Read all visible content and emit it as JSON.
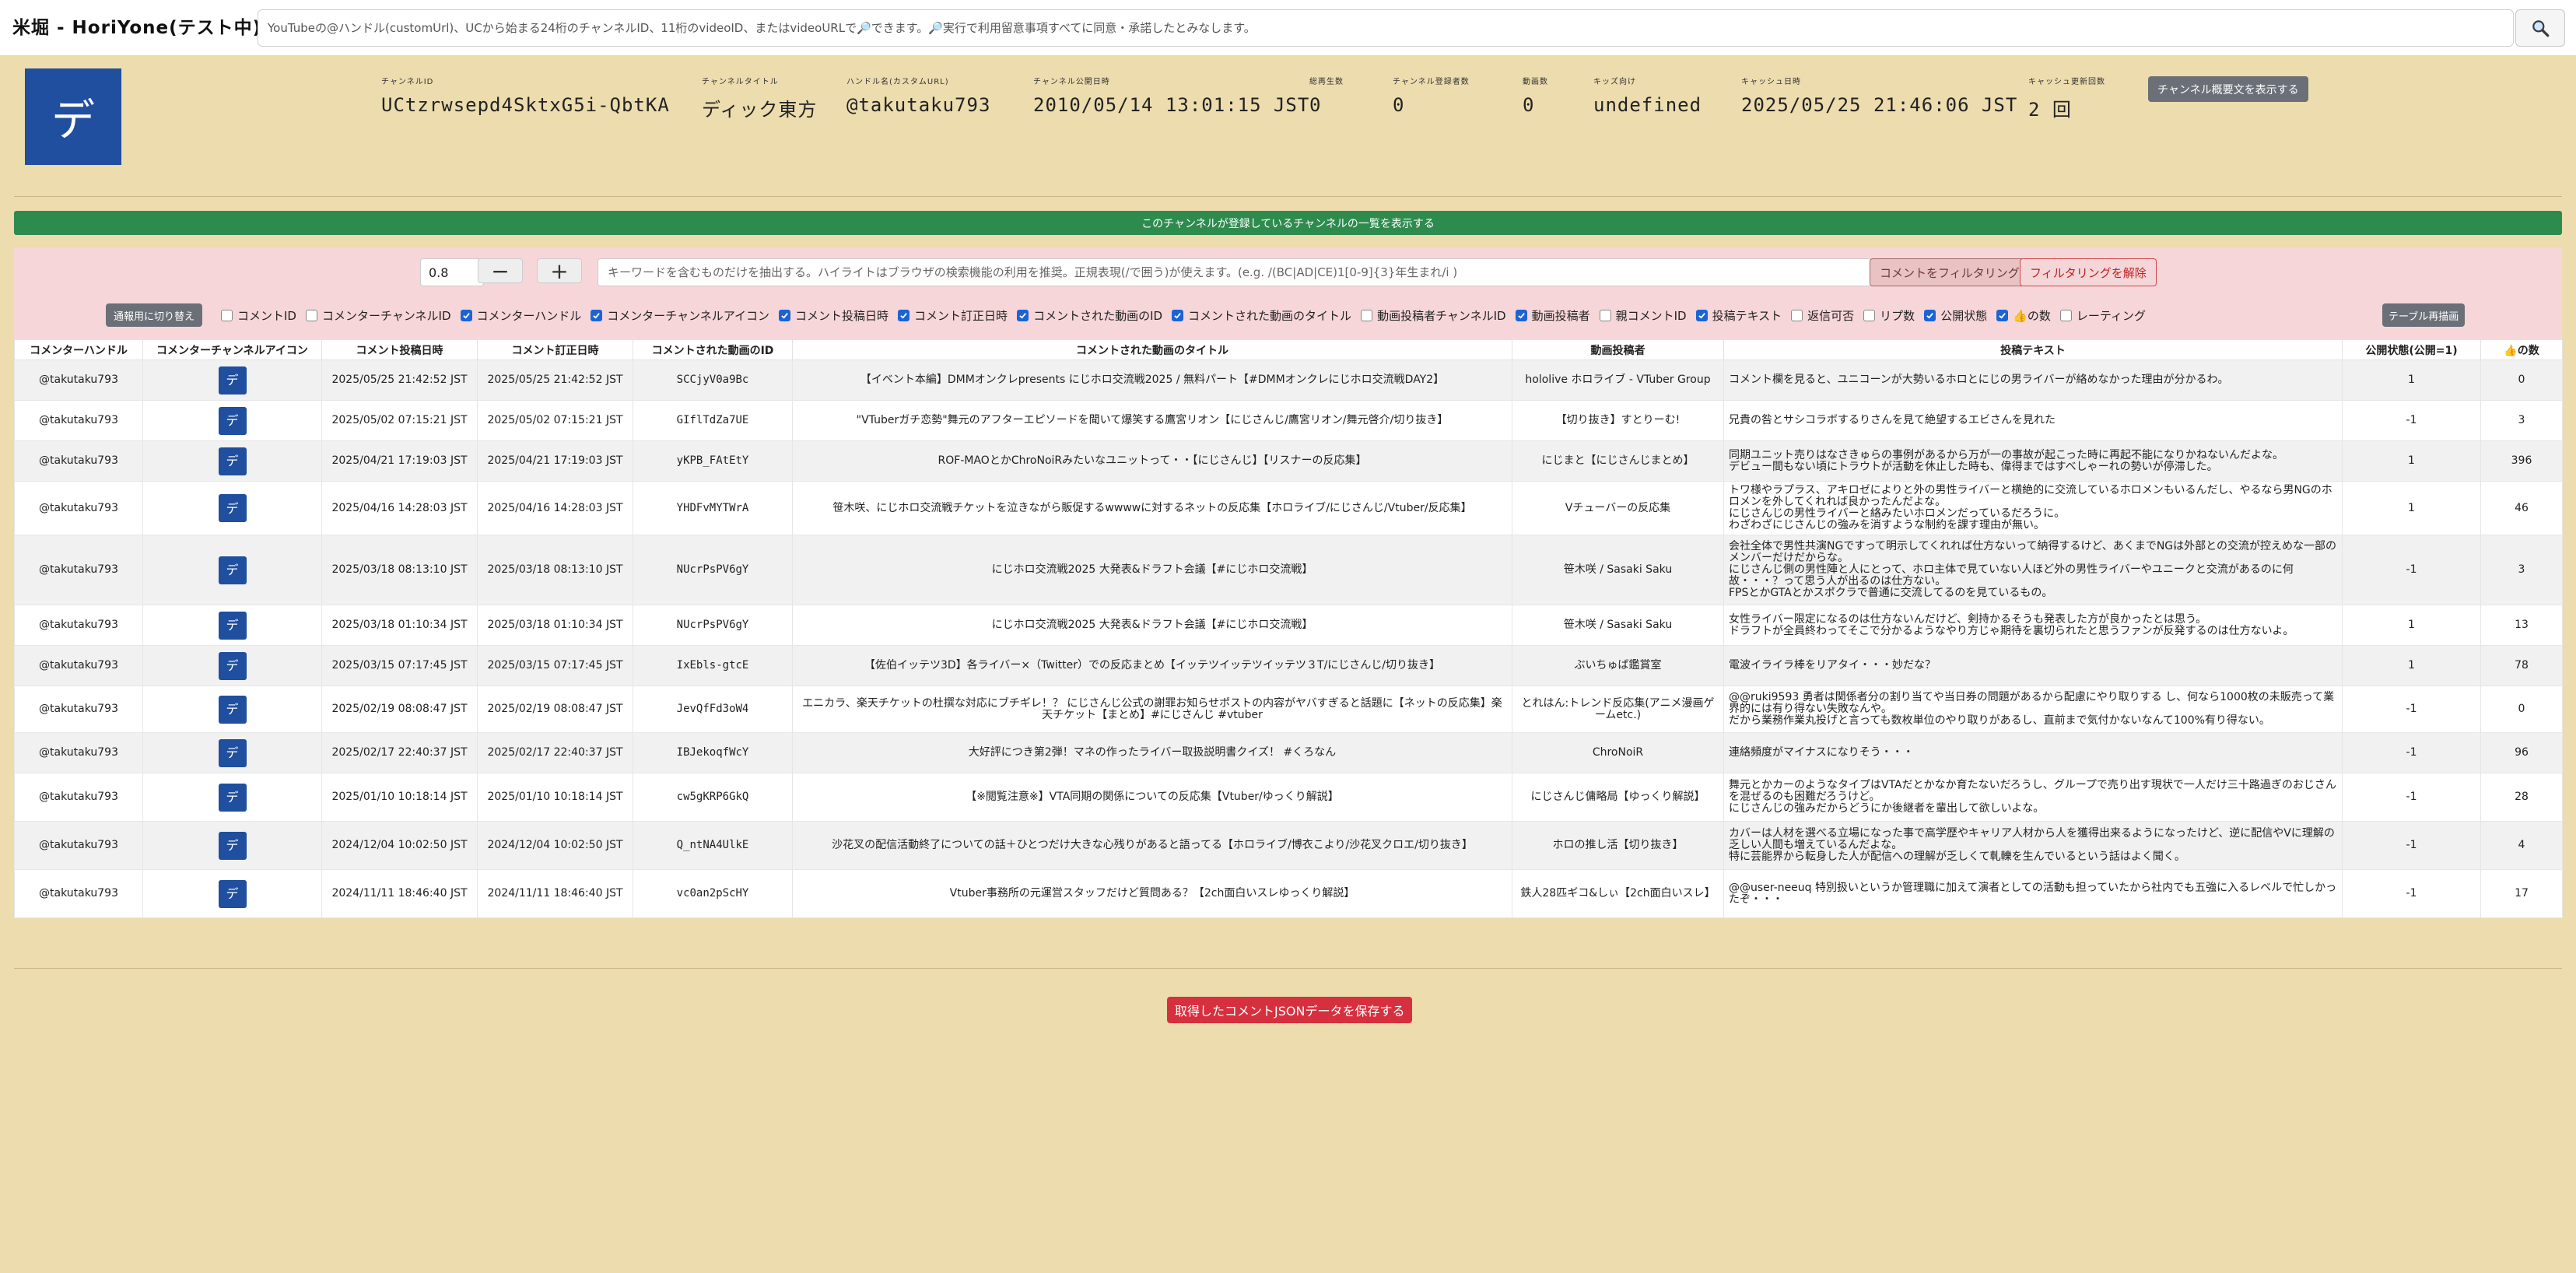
{
  "header": {
    "title": "米堀 - HoriYone(テスト中)",
    "search_placeholder": "YouTubeの@ハンドル(customUrl)、UCから始まる24桁のチャンネルID、11桁のvideoID、またはvideoURLで🔎できます。🔎実行で利用留意事項すべてに同意・承諾したとみなします。"
  },
  "channel": {
    "avatar_char": "デ",
    "stats": [
      {
        "label": "チャンネルID",
        "value": "UCtzrwsepd4SktxG5i-QbtKA"
      },
      {
        "label": "チャンネルタイトル",
        "value": "ディック東方"
      },
      {
        "label": "ハンドル名(カスタムURL)",
        "value": "@takutaku793"
      },
      {
        "label": "チャンネル公開日時",
        "value": "2010/05/14 13:01:15 JST"
      },
      {
        "label": "総再生数",
        "value": "0"
      },
      {
        "label": "チャンネル登録者数",
        "value": "0"
      },
      {
        "label": "動画数",
        "value": "0"
      },
      {
        "label": "キッズ向け",
        "value": "undefined"
      },
      {
        "label": "キャッシュ日時",
        "value": "2025/05/25 21:46:06 JST"
      },
      {
        "label": "キャッシュ更新回数",
        "value": "2 回"
      }
    ],
    "desc_button": "チャンネル概要文を表示する"
  },
  "subs_button": "このチャンネルが登録しているチャンネルの一覧を表示する",
  "filter": {
    "threshold": "0.8",
    "minus": "−",
    "plus": "+",
    "keyword_placeholder": "キーワードを含むものだけを抽出する。ハイライトはブラウザの検索機能の利用を推奨。正規表現(/で囲う)が使えます。(e.g. /(BC|AD|CE)1[0-9]{3}年生まれ/i )",
    "apply": "コメントをフィルタリング",
    "clear": "フィルタリングを解除",
    "toggle_view": "通報用に切り替え",
    "redraw": "テーブル再描画",
    "columns": [
      {
        "label": "コメントID",
        "checked": false
      },
      {
        "label": "コメンターチャンネルID",
        "checked": false
      },
      {
        "label": "コメンターハンドル",
        "checked": true
      },
      {
        "label": "コメンターチャンネルアイコン",
        "checked": true
      },
      {
        "label": "コメント投稿日時",
        "checked": true
      },
      {
        "label": "コメント訂正日時",
        "checked": true
      },
      {
        "label": "コメントされた動画のID",
        "checked": true
      },
      {
        "label": "コメントされた動画のタイトル",
        "checked": true
      },
      {
        "label": "動画投稿者チャンネルID",
        "checked": false
      },
      {
        "label": "動画投稿者",
        "checked": true
      },
      {
        "label": "親コメントID",
        "checked": false
      },
      {
        "label": "投稿テキスト",
        "checked": true
      },
      {
        "label": "返信可否",
        "checked": false
      },
      {
        "label": "リプ数",
        "checked": false
      },
      {
        "label": "公開状態",
        "checked": true
      },
      {
        "label": "👍の数",
        "checked": true
      },
      {
        "label": "レーティング",
        "checked": false
      }
    ]
  },
  "table": {
    "headers": [
      "コメンターハンドル",
      "コメンターチャンネルアイコン",
      "コメント投稿日時",
      "コメント訂正日時",
      "コメントされた動画のID",
      "コメントされた動画のタイトル",
      "動画投稿者",
      "投稿テキスト",
      "公開状態(公開=1)",
      "👍の数"
    ],
    "rows": [
      {
        "handle": "@takutaku793",
        "icon": "デ",
        "posted": "2025/05/25 21:42:52 JST",
        "edited": "2025/05/25 21:42:52 JST",
        "vid": "SCCjyV0a9Bc",
        "title": "【イベント本編】DMMオンクレpresents にじホロ交流戦2025 / 無料パート【#DMMオンクレにじホロ交流戦DAY2】",
        "uploader": "hololive ホロライブ - VTuber Group",
        "text": "コメント欄を見ると、ユニコーンが大勢いるホロとにじの男ライバーが絡めなかった理由が分かるわ。",
        "status": "1",
        "likes": "0"
      },
      {
        "handle": "@takutaku793",
        "icon": "デ",
        "posted": "2025/05/02 07:15:21 JST",
        "edited": "2025/05/02 07:15:21 JST",
        "vid": "GIflTdZa7UE",
        "title": "\"VTuberガチ恋勢\"舞元⁠⁠のアフターエピソードを聞いて爆笑する鷹宮リオン【にじさんじ/鷹宮リオン/舞元啓介/切り抜き】",
        "uploader": "【切り抜き】すとりーむ!",
        "text": "兄貴の咎とサシコラボするりさんを見て絶望するエビさんを見れた",
        "status": "-1",
        "likes": "3"
      },
      {
        "handle": "@takutaku793",
        "icon": "デ",
        "posted": "2025/04/21 17:19:03 JST",
        "edited": "2025/04/21 17:19:03 JST",
        "vid": "yKPB_FAtEtY",
        "title": "ROF-MAOとかChroNoiRみたいなユニットって・・【にじさんじ】【リスナーの反応集】",
        "uploader": "にじまと【にじさんじまとめ】",
        "text": "同期ユニット売りはなさきゅらの事例があるから万が一の事故が起こった時に再起不能になりかねないんだよな。\nデビュー間もない頃にトラウトが活動を休止した時も、偉得まではすべしゃーれの勢いが停滞した。",
        "status": "1",
        "likes": "396"
      },
      {
        "handle": "@takutaku793",
        "icon": "デ",
        "posted": "2025/04/16 14:28:03 JST",
        "edited": "2025/04/16 14:28:03 JST",
        "vid": "YHDFvMYTWrA",
        "title": "笹木咲、にじホロ交流戦チケットを泣きながら販促するwwwwに対するネットの反応集【ホロライブ/にじさんじ/Vtuber/反応集】",
        "uploader": "Vチューバーの反応集",
        "text": "トワ様やラプラス、アキロゼによりと外の男性ライバーと横絶的に交流しているホロメンもいるんだし、やるなら男NGのホロメンを外してくれれば良かったんだよな。\nにじさんじの男性ライバーと絡みたいホロメンだっているだろうに。\nわざわざにじさんじの強みを消すような制約を課す理由が無い。",
        "status": "1",
        "likes": "46"
      },
      {
        "handle": "@takutaku793",
        "icon": "デ",
        "posted": "2025/03/18 08:13:10 JST",
        "edited": "2025/03/18 08:13:10 JST",
        "vid": "NUcrPsPV6gY",
        "title": "にじホロ交流戦2025 大発表&ドラフト会議【#にじホロ交流戦】",
        "uploader": "笹木咲 / Sasaki Saku",
        "text": "会社全体で男性共演NGですって明示してくれれば仕方ないって納得するけど、あくまでNGは外部との交流が控えめな一部のメンバーだけだからな。\nにじさんじ側の男性陣と人にとって、ホロ主体で見ていない人ほど外の男性ライバーやユニークと交流があるのに何故・・・？って思う人が出るのは仕方ない。\nFPSとかGTAとかスポクラで普通に交流してるのを見ているもの。",
        "status": "-1",
        "likes": "3"
      },
      {
        "handle": "@takutaku793",
        "icon": "デ",
        "posted": "2025/03/18 01:10:34 JST",
        "edited": "2025/03/18 01:10:34 JST",
        "vid": "NUcrPsPV6gY",
        "title": "にじホロ交流戦2025 大発表&ドラフト会議【#にじホロ交流戦】",
        "uploader": "笹木咲 / Sasaki Saku",
        "text": "女性ライバー限定になるのは仕方ないんだけど、剣持かるそうも発表した方が良かったとは思う。\nドラフトが全員終わってそこで分かるようなやり方じゃ期待を裏切られたと思うファンが反発するのは仕方ないよ。",
        "status": "1",
        "likes": "13"
      },
      {
        "handle": "@takutaku793",
        "icon": "デ",
        "posted": "2025/03/15 07:17:45 JST",
        "edited": "2025/03/15 07:17:45 JST",
        "vid": "IxEbls-gtcE",
        "title": "【佐伯イッテツ3D】各ライバー×（Twitter）での反応まとめ【イッテツイッテツイッテツ３T/にじさんじ/切り抜き】",
        "uploader": "ぶいちゅば鑑賞室",
        "text": "電波イライラ棒をリアタイ・・・妙だな？",
        "status": "1",
        "likes": "78"
      },
      {
        "handle": "@takutaku793",
        "icon": "デ",
        "posted": "2025/02/19 08:08:47 JST",
        "edited": "2025/02/19 08:08:47 JST",
        "vid": "JevQfFd3oW4",
        "title": "エニカラ、楽天チケットの杜撰な対応にブチギレ！？ にじさんじ公式の謝罪お知らせポストの内容がヤバすぎると話題に【ネットの反応集】楽天チケット【まとめ】#にじさんじ #vtuber",
        "uploader": "とれはん:トレンド反応集(アニメ漫画ゲームetc.)",
        "text": "@@ruki9593 勇者は関係者分の割り当てや当日券の問題があるから配慮にやり取りする し、何なら1000枚の未販売って業界的には有り得ない失敗なんや。\nだから業務作業丸投げと言っても数枚単位のやり取りがあるし、直前まで気付かないなんて100%有り得ない。",
        "status": "-1",
        "likes": "0"
      },
      {
        "handle": "@takutaku793",
        "icon": "デ",
        "posted": "2025/02/17 22:40:37 JST",
        "edited": "2025/02/17 22:40:37 JST",
        "vid": "IBJekoqfWcY",
        "title": "大好評につき第2弾！マネの作ったライバー取扱説明書クイズ！ #くろなん",
        "uploader": "ChroNoiR",
        "text": "連絡頻度がマイナスになりそう・・・",
        "status": "-1",
        "likes": "96"
      },
      {
        "handle": "@takutaku793",
        "icon": "デ",
        "posted": "2025/01/10 10:18:14 JST",
        "edited": "2025/01/10 10:18:14 JST",
        "vid": "cw5gKRP6GkQ",
        "title": "【※閲覧注意※】VTA同期の関係についての反応集【Vtuber/ゆっくり解説】",
        "uploader": "にじさんじ傭略局【ゆっくり解説】",
        "text": "舞元とかカーのようなタイプはVTAだとかなか育たないだろうし、グループで売り出す現状で一人だけ三十路過ぎのおじさんを混ぜるのも困難だろうけど。\nにじさんじの強みだからどうにか後継者を輩出して欲しいよな。",
        "status": "-1",
        "likes": "28"
      },
      {
        "handle": "@takutaku793",
        "icon": "デ",
        "posted": "2024/12/04 10:02:50 JST",
        "edited": "2024/12/04 10:02:50 JST",
        "vid": "Q_ntNA4UlkE",
        "title": "沙花叉の配信活動終了についての話＋ひとつだけ大きな心残りがあると語ってる【ホロライブ/博衣こより/沙花叉クロエ/切り抜き】",
        "uploader": "ホロの推し活【切り抜き】",
        "text": "カバーは人材を選べる立場になった事で高学歴やキャリア人材から人を獲得出来るようになったけど、逆に配信やVに理解の乏しい人間も増えているんだよな。\n特に芸能界から転身した人が配信への理解が乏しくて軋轢を生んでいるという話はよく聞く。",
        "status": "-1",
        "likes": "4"
      },
      {
        "handle": "@takutaku793",
        "icon": "デ",
        "posted": "2024/11/11 18:46:40 JST",
        "edited": "2024/11/11 18:46:40 JST",
        "vid": "vc0an2pScHY",
        "title": "Vtuber事務所の元運営スタッフだけど質問ある？【2ch面白いスレゆっくり解説】",
        "uploader": "鉄人28匹ギコ&しぃ【2ch面白いスレ】",
        "text": "@@user-neeuq 特別扱いというか管理職に加えて演者としての活動も担っていたから社内でも五強に入るレベルで忙しかったぞ・・・",
        "status": "-1",
        "likes": "17"
      }
    ]
  },
  "save_button": "取得したコメントJSONデータを保存する"
}
